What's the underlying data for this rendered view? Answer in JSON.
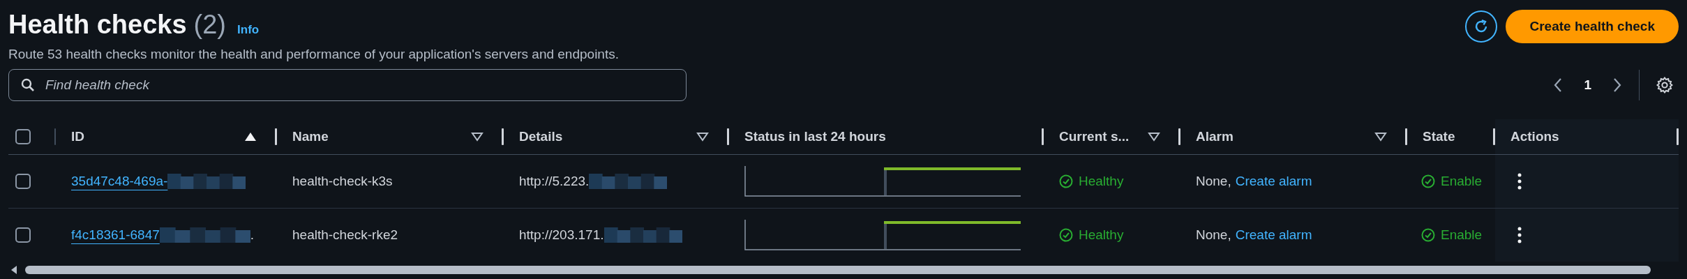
{
  "header": {
    "title": "Health checks",
    "count": "(2)",
    "info": "Info",
    "description": "Route 53 health checks monitor the health and performance of your application's servers and endpoints.",
    "create_button": "Create health check"
  },
  "search": {
    "placeholder": "Find health check"
  },
  "pagination": {
    "pages": [
      {
        "label": "1",
        "selected": true
      }
    ]
  },
  "table": {
    "select_all": {
      "checked": false
    },
    "columns": [
      {
        "label": "ID",
        "sortable": true,
        "sorted": true
      },
      {
        "label": "Name",
        "sortable": true,
        "sorted": false
      },
      {
        "label": "Details",
        "sortable": true,
        "sorted": false
      },
      {
        "label": "Status in last 24 hours",
        "sortable": false
      },
      {
        "label": "Current s...",
        "sortable": true,
        "sorted": false
      },
      {
        "label": "Alarm",
        "sortable": true,
        "sorted": false
      },
      {
        "label": "State",
        "sortable": false
      },
      {
        "label": "Actions",
        "sortable": false
      }
    ],
    "rows": [
      {
        "checked": false,
        "id": "35d47c48-469a-",
        "id_suffix": "",
        "name": "health-check-k3s",
        "details": "http://5.223.",
        "status": {
          "label": "Healthy",
          "kind": "ok"
        },
        "alarm": "None,",
        "alarm_link": "Create alarm",
        "state": {
          "label": "Enable",
          "kind": "ok"
        }
      },
      {
        "checked": false,
        "id": "f4c18361-6847",
        "id_suffix": ".",
        "name": "health-check-rke2",
        "details": "http://203.171.",
        "status": {
          "label": "Healthy",
          "kind": "ok"
        },
        "alarm": "None,",
        "alarm_link": "Create alarm",
        "state": {
          "label": "Enable",
          "kind": "ok"
        }
      }
    ]
  }
}
